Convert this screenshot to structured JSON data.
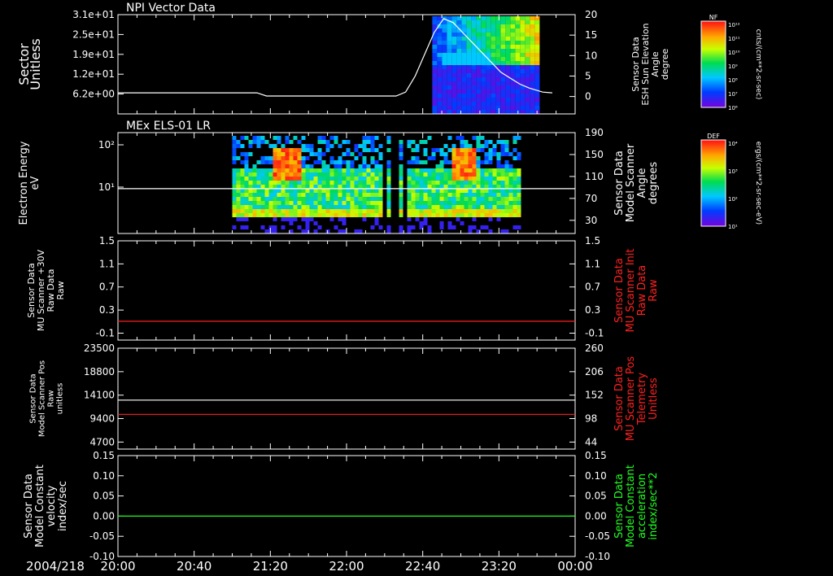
{
  "chart_data": [
    {
      "type": "heatmap",
      "title": "NPI Vector Data",
      "ylabel": [
        "Sector",
        "Unitless"
      ],
      "yticks": [
        "3.1e+01",
        "2.5e+01",
        "1.9e+01",
        "1.2e+01",
        "6.2e+00"
      ],
      "y2label": [
        "Sensor Data",
        "ESH Sun Elevation",
        "Angle",
        "degree"
      ],
      "y2ticks": [
        "20",
        "15",
        "10",
        "5",
        "0"
      ],
      "y2lim": [
        -5,
        20
      ],
      "colorbar": {
        "label": "NF",
        "unit": "cnts/(cm**2-sr-sec)",
        "ticks": [
          "10¹²",
          "10¹¹",
          "10¹⁰",
          "10⁹",
          "10⁸",
          "10⁷",
          "10⁶"
        ]
      },
      "series": [
        {
          "x": [
            "20:00",
            "21:13",
            "21:18",
            "22:26",
            "22:31",
            "22:36",
            "22:41",
            "22:46",
            "22:51",
            "22:56",
            "23:01",
            "23:06",
            "23:11",
            "23:16",
            "23:21",
            "23:26",
            "23:31",
            "23:36",
            "23:43",
            "23:48"
          ],
          "y": [
            0.3,
            0.3,
            -0.5,
            -0.5,
            0.5,
            4.5,
            10,
            15.5,
            19,
            18,
            15.5,
            13,
            10.5,
            8,
            5.5,
            4,
            2.5,
            1.5,
            0.5,
            0.3
          ]
        }
      ]
    },
    {
      "type": "heatmap",
      "title": "MEx ELS-01 LR",
      "ylabel": [
        "Electron Energy",
        "eV"
      ],
      "yticks": [
        "10²",
        "10¹"
      ],
      "y2label": [
        "Sensor Data",
        "Model Scanner",
        "Angle",
        "degrees"
      ],
      "y2ticks": [
        "190",
        "150",
        "110",
        "70",
        "30"
      ],
      "y2lim": [
        10,
        190
      ],
      "colorbar": {
        "label": "DEF",
        "unit": "ergs/(cm**2-sr-sec-eV)",
        "ticks": [
          "10⁴",
          "10³",
          "10²",
          "10¹"
        ]
      },
      "series": [
        {
          "x": [
            "20:00",
            "00:00"
          ],
          "y": [
            90,
            90
          ]
        }
      ]
    },
    {
      "type": "line",
      "ylabel": [
        "Sensor Data",
        "MU Scanner +30V",
        "Raw Data",
        "Raw"
      ],
      "yticks": [
        "1.5",
        "1.1",
        "0.7",
        "0.3",
        "-0.1"
      ],
      "ylim": [
        -0.35,
        1.5
      ],
      "y2label": [
        "Sensor Data",
        "MU Scanner Init",
        "Raw Data",
        "Raw"
      ],
      "y2ticks": [
        "1.5",
        "1.1",
        "0.7",
        "0.3",
        "-0.1"
      ],
      "series": [
        {
          "color": "#ff2020",
          "x": [
            "20:00",
            "00:00"
          ],
          "y": [
            0.0,
            0.0
          ]
        }
      ]
    },
    {
      "type": "line",
      "ylabel": [
        "Sensor Data",
        "Model Scanner Pos",
        "Raw",
        "unitless"
      ],
      "yticks": [
        "23500",
        "18800",
        "14100",
        "9400",
        "4700"
      ],
      "ylim": [
        0,
        23500
      ],
      "y2label": [
        "Sensor Data",
        "MU Scanner Pos",
        "Telemetry",
        "Unitless"
      ],
      "y2ticks": [
        "260",
        "206",
        "152",
        "98",
        "44"
      ],
      "series": [
        {
          "color": "#ffffff",
          "x": [
            "20:00",
            "00:00"
          ],
          "y": [
            11400,
            11400
          ]
        },
        {
          "color": "#ff2020",
          "x": [
            "20:00",
            "00:00"
          ],
          "y": [
            8100,
            8100
          ]
        }
      ]
    },
    {
      "type": "line",
      "ylabel": [
        "Sensor Data",
        "Model Constant",
        "velocity",
        "index/sec"
      ],
      "yticks": [
        "0.15",
        "0.10",
        "0.05",
        "0.00",
        "-0.05",
        "-0.10"
      ],
      "ylim": [
        -0.1,
        0.15
      ],
      "y2label": [
        "Sensor Data",
        "Model Constant",
        "acceleration",
        "index/sec**2"
      ],
      "y2ticks": [
        "0.15",
        "0.10",
        "0.05",
        "0.00",
        "-0.05",
        "-0.10"
      ],
      "series": [
        {
          "color": "#20ff20",
          "x": [
            "20:00",
            "00:00"
          ],
          "y": [
            0.0,
            0.0
          ]
        }
      ]
    }
  ],
  "xaxis": {
    "date": "2004/218",
    "ticks": [
      "20:00",
      "20:40",
      "21:20",
      "22:00",
      "22:40",
      "23:20",
      "00:00"
    ]
  },
  "colors": {
    "y2label_panel3": "#ff2020",
    "y2label_panel4": "#ff2020",
    "y2label_panel5": "#20ff20"
  }
}
